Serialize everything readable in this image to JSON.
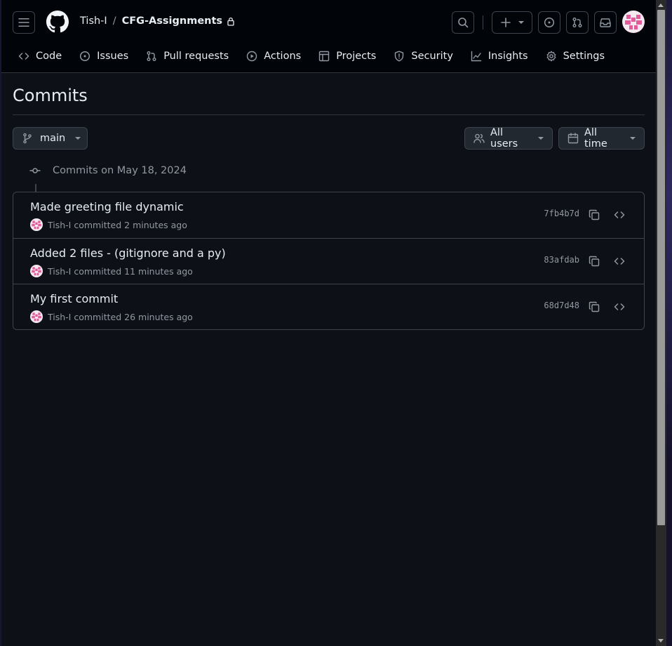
{
  "header": {
    "owner": "Tish-I",
    "separator": "/",
    "repo": "CFG-Assignments"
  },
  "nav": {
    "items": [
      {
        "label": "Code",
        "icon": "code-icon"
      },
      {
        "label": "Issues",
        "icon": "issue-icon"
      },
      {
        "label": "Pull requests",
        "icon": "pull-request-icon"
      },
      {
        "label": "Actions",
        "icon": "play-icon"
      },
      {
        "label": "Projects",
        "icon": "table-icon"
      },
      {
        "label": "Security",
        "icon": "shield-icon"
      },
      {
        "label": "Insights",
        "icon": "graph-icon"
      },
      {
        "label": "Settings",
        "icon": "gear-icon"
      }
    ]
  },
  "page": {
    "title": "Commits",
    "branch": "main",
    "users_filter": "All users",
    "time_filter": "All time"
  },
  "group": {
    "label": "Commits on May 18, 2024"
  },
  "commits": [
    {
      "title": "Made greeting file dynamic",
      "author": "Tish-I",
      "verb": "committed",
      "time": "2 minutes ago",
      "sha": "7fb4b7d"
    },
    {
      "title": "Added 2 files - (gitignore and a py)",
      "author": "Tish-I",
      "verb": "committed",
      "time": "11 minutes ago",
      "sha": "83afdab"
    },
    {
      "title": "My first commit",
      "author": "Tish-I",
      "verb": "committed",
      "time": "26 minutes ago",
      "sha": "68d7d48"
    }
  ],
  "colors": {
    "background": "#0d1117",
    "header": "#010409",
    "border": "#3d444d",
    "muted": "#9198a1",
    "avatar": "#e25b9b"
  }
}
